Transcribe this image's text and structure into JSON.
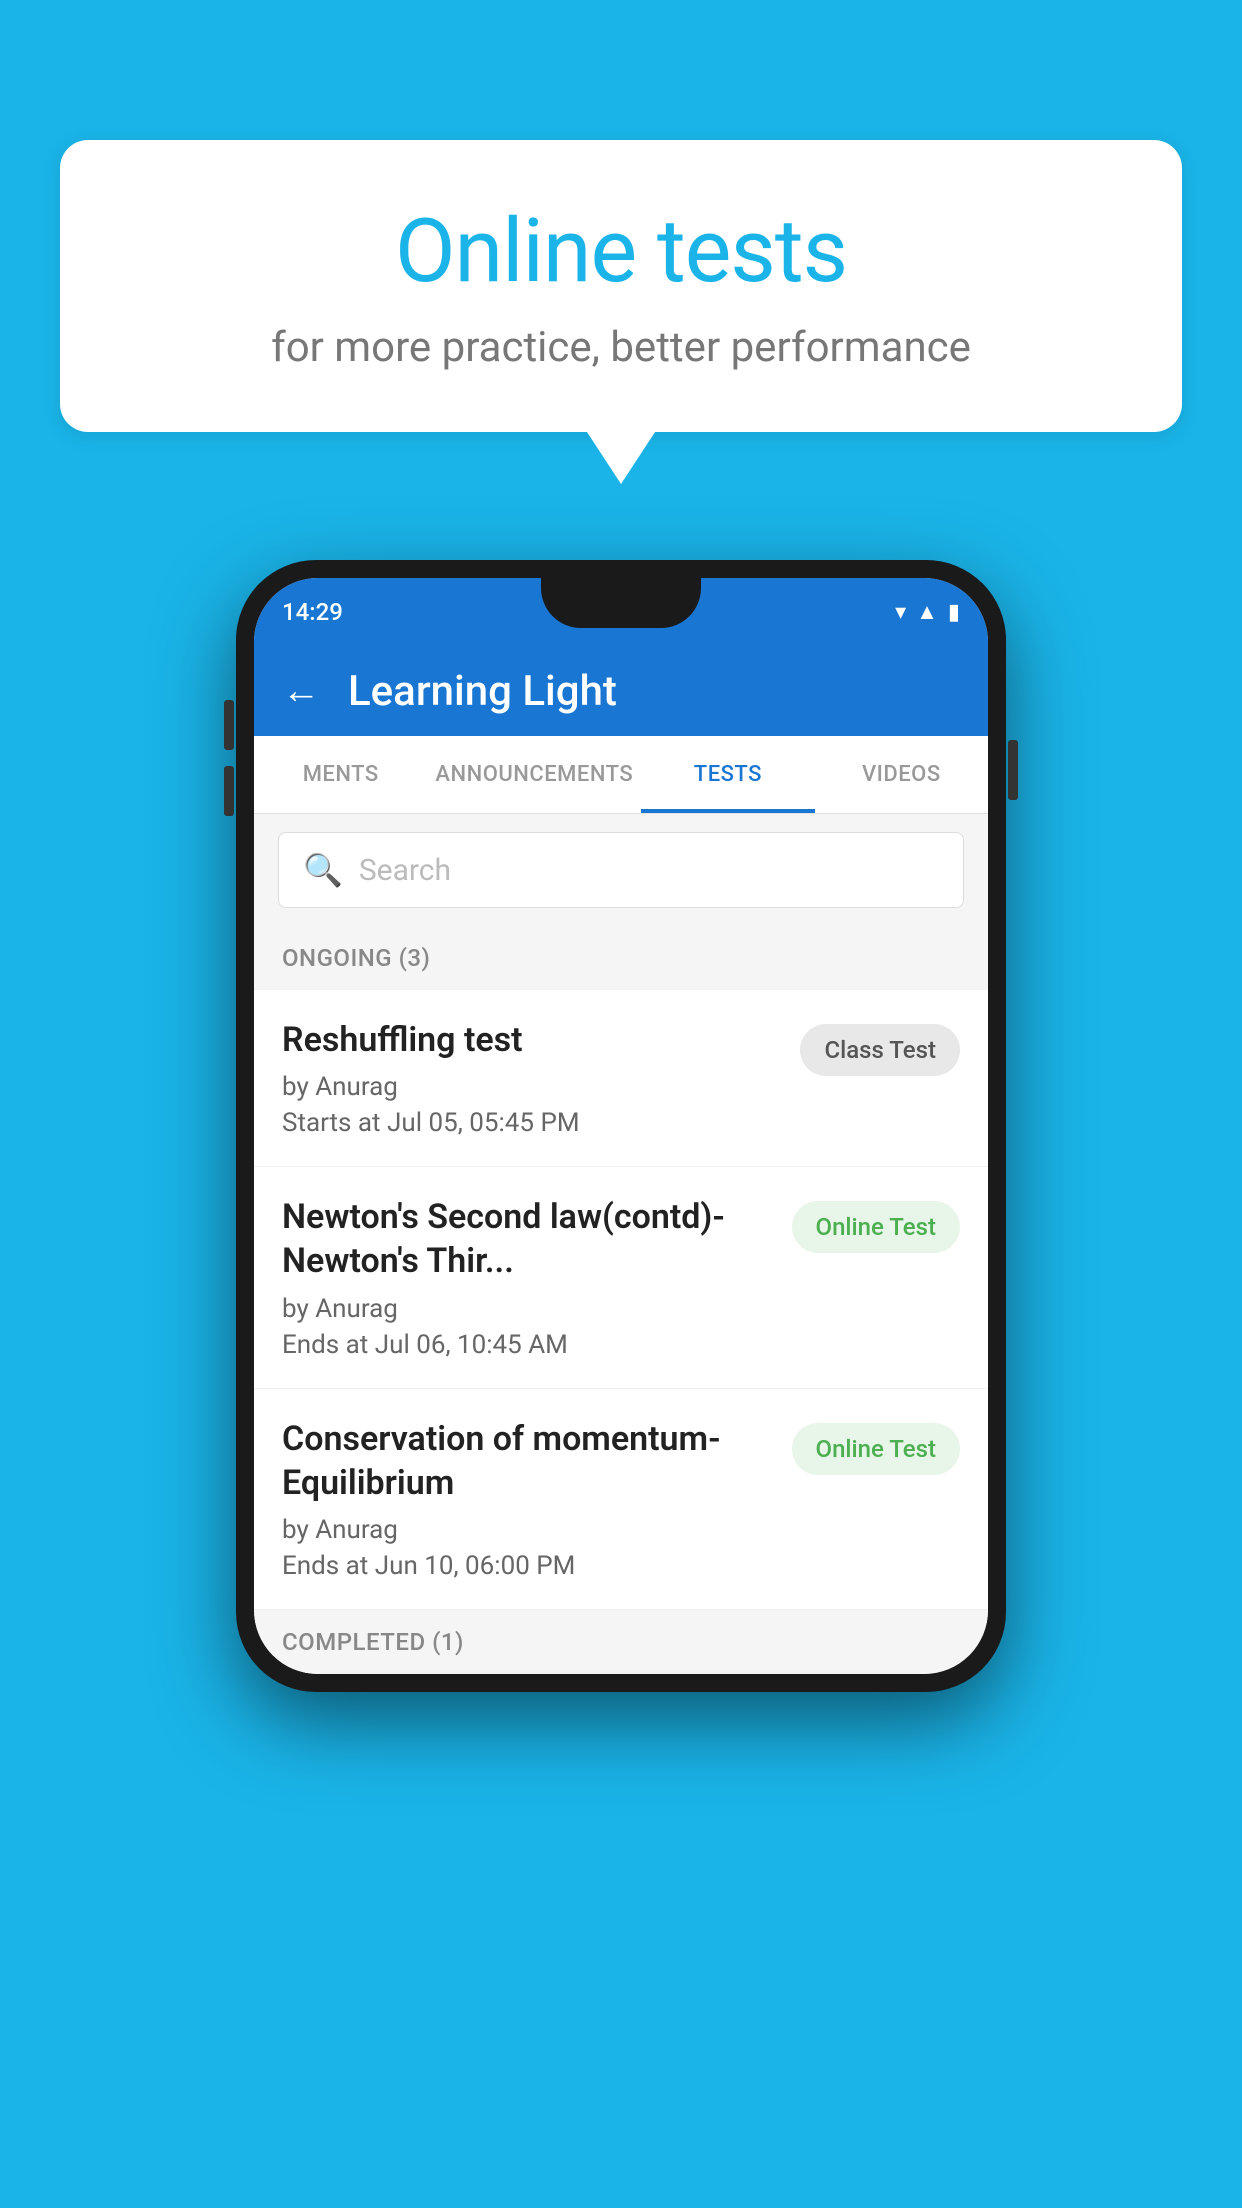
{
  "background_color": "#1ab4e8",
  "bubble": {
    "title": "Online tests",
    "subtitle": "for more practice, better performance"
  },
  "phone": {
    "status_bar": {
      "time": "14:29",
      "icons": [
        "wifi",
        "signal",
        "battery"
      ]
    },
    "app_header": {
      "title": "Learning Light",
      "back_label": "←"
    },
    "tabs": [
      {
        "label": "MENTS",
        "active": false
      },
      {
        "label": "ANNOUNCEMENTS",
        "active": false
      },
      {
        "label": "TESTS",
        "active": true
      },
      {
        "label": "VIDEOS",
        "active": false
      }
    ],
    "search": {
      "placeholder": "Search"
    },
    "section_ongoing": {
      "label": "ONGOING (3)"
    },
    "tests": [
      {
        "name": "Reshuffling test",
        "author": "by Anurag",
        "time_label": "Starts at",
        "time": "Jul 05, 05:45 PM",
        "badge": "Class Test",
        "badge_type": "class"
      },
      {
        "name": "Newton's Second law(contd)-Newton's Thir...",
        "author": "by Anurag",
        "time_label": "Ends at",
        "time": "Jul 06, 10:45 AM",
        "badge": "Online Test",
        "badge_type": "online"
      },
      {
        "name": "Conservation of momentum-Equilibrium",
        "author": "by Anurag",
        "time_label": "Ends at",
        "time": "Jun 10, 06:00 PM",
        "badge": "Online Test",
        "badge_type": "online"
      }
    ],
    "section_completed": {
      "label": "COMPLETED (1)"
    }
  }
}
